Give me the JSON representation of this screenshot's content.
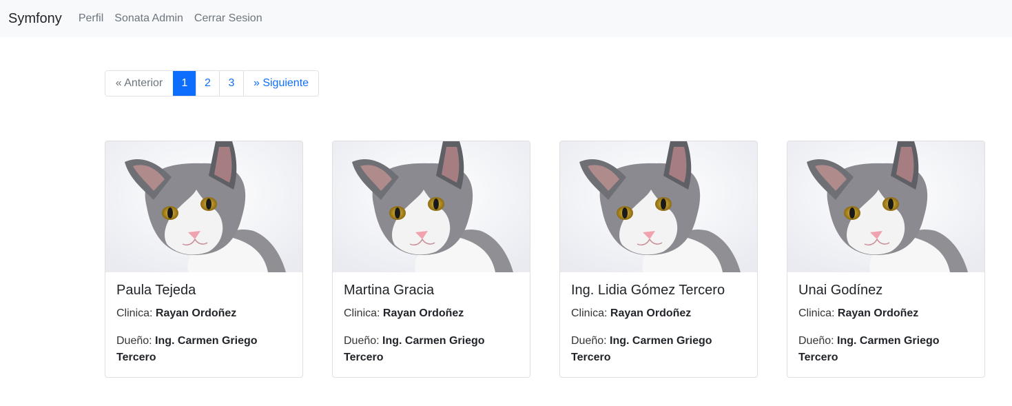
{
  "navbar": {
    "brand": "Symfony",
    "links": [
      {
        "label": "Perfil"
      },
      {
        "label": "Sonata Admin"
      },
      {
        "label": "Cerrar Sesion"
      }
    ]
  },
  "pagination": {
    "prev_label": "« Anterior",
    "pages": [
      "1",
      "2",
      "3"
    ],
    "active_page": "1",
    "next_label": "» Siguiente"
  },
  "cards": [
    {
      "name": "Paula Tejeda",
      "clinic_label": "Clinica:",
      "clinic": "Rayan Ordoñez",
      "owner_label": "Dueño:",
      "owner": "Ing. Carmen Griego Tercero",
      "image": "cat-photo"
    },
    {
      "name": "Martina Gracia",
      "clinic_label": "Clinica:",
      "clinic": "Rayan Ordoñez",
      "owner_label": "Dueño:",
      "owner": "Ing. Carmen Griego Tercero",
      "image": "cat-photo"
    },
    {
      "name": "Ing. Lidia Gómez Tercero",
      "clinic_label": "Clinica:",
      "clinic": "Rayan Ordoñez",
      "owner_label": "Dueño:",
      "owner": "Ing. Carmen Griego Tercero",
      "image": "cat-photo"
    },
    {
      "name": "Unai Godínez",
      "clinic_label": "Clinica:",
      "clinic": "Rayan Ordoñez",
      "owner_label": "Dueño:",
      "owner": "Ing. Carmen Griego Tercero",
      "image": "cat-photo"
    }
  ],
  "colors": {
    "navbar_bg": "#f8f9fa",
    "link_blue": "#0d6efd",
    "active_page_bg": "#0d6efd"
  }
}
